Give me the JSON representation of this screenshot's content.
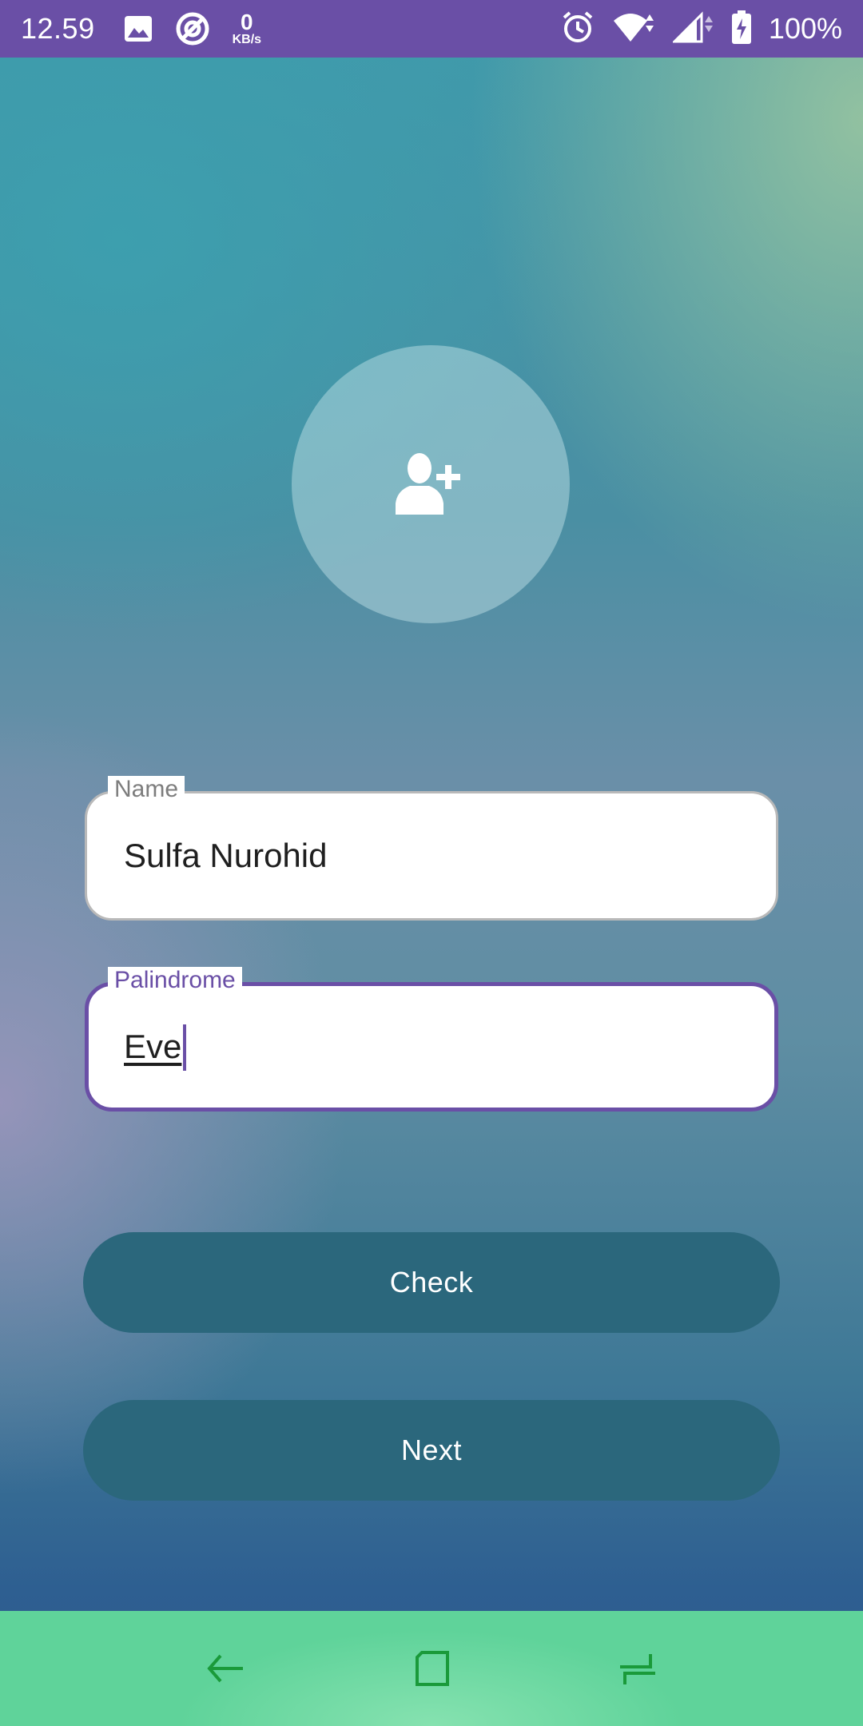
{
  "status_bar": {
    "time": "12.59",
    "network_speed_value": "0",
    "network_speed_unit": "KB/s",
    "battery_percent": "100%",
    "icons": [
      "image-icon",
      "data-saver-icon",
      "alarm-icon",
      "wifi-icon",
      "signal-icon",
      "battery-charging-icon"
    ]
  },
  "avatar": {
    "icon": "add-user-icon"
  },
  "form": {
    "name": {
      "label": "Name",
      "value": "Sulfa Nurohid"
    },
    "palindrome": {
      "label": "Palindrome",
      "value": "Eve"
    }
  },
  "buttons": {
    "check_label": "Check",
    "next_label": "Next"
  },
  "nav_bar": {
    "icons": [
      "back-icon",
      "home-icon",
      "recents-icon"
    ]
  },
  "colors": {
    "accent": "#6a4fa6",
    "button": "#2b677c",
    "nav_bar": "#5fd39a",
    "nav_icon": "#1a9a3a"
  }
}
